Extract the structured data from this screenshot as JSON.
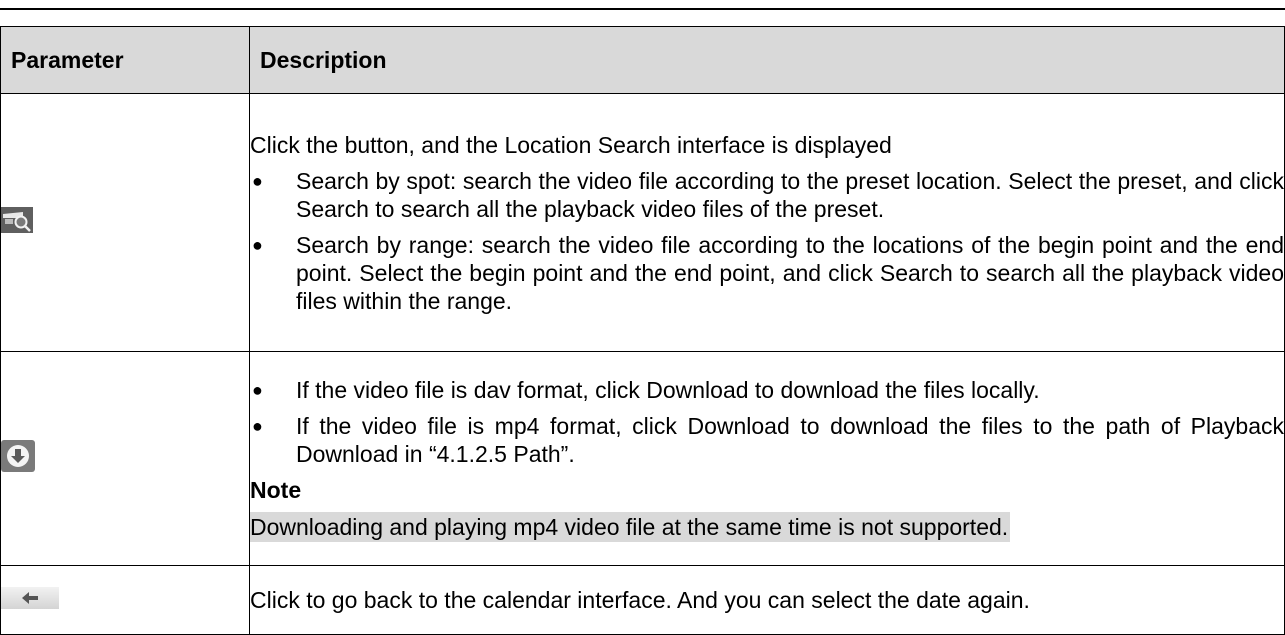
{
  "table": {
    "headers": {
      "param": "Parameter",
      "desc": "Description"
    },
    "rows": {
      "search": {
        "icon": "location-search-icon",
        "intro": "Click the button, and the Location Search interface is displayed",
        "bullets": [
          "Search by spot: search the video file according to the preset location. Select the preset, and click Search to search all the playback video files of the preset.",
          "Search by range: search the video file according to the locations of the begin point and the end point. Select the begin point and the end point, and click Search to search all the playback video files within the range."
        ]
      },
      "download": {
        "icon": "download-icon",
        "bullets": [
          "If the video file is dav format, click Download to download the files locally.",
          "If the video file is mp4 format, click Download to download the files to the path of Playback Download in “4.1.2.5 Path”."
        ],
        "note_label": "Note",
        "note_text": "Downloading and playing mp4 video file at the same time is not supported."
      },
      "back": {
        "icon": "back-arrow-icon",
        "text": "Click to go back to the calendar interface. And you can select the date again."
      }
    }
  },
  "colors": {
    "header_bg": "#d9d9d9",
    "icon_bg": "#7a7a7a",
    "note_bg": "#d9d9d9"
  }
}
